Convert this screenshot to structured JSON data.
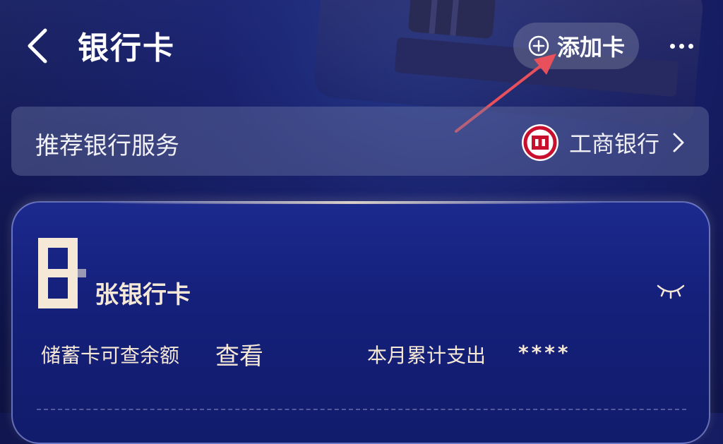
{
  "header": {
    "title": "银行卡",
    "add_card_label": "添加卡"
  },
  "recommend": {
    "title": "推荐银行服务",
    "bank_name": "工商银行"
  },
  "card": {
    "count_suffix": "张银行卡",
    "balance_label": "储蓄卡可查余额",
    "balance_action": "查看",
    "monthly_spend_label": "本月累计支出",
    "monthly_spend_value": "****"
  },
  "colors": {
    "background": "#151c5c",
    "card": "#18248a",
    "card_text": "#f5e8d6",
    "annotation_arrow": "#e8505b",
    "icbc_red": "#c8102e"
  },
  "icons": {
    "back": "back-arrow-icon",
    "add": "plus-circle-icon",
    "more": "more-dots-icon",
    "bank_logo": "icbc-logo-icon",
    "chevron": "chevron-right-icon",
    "eye": "eye-closed-icon"
  }
}
